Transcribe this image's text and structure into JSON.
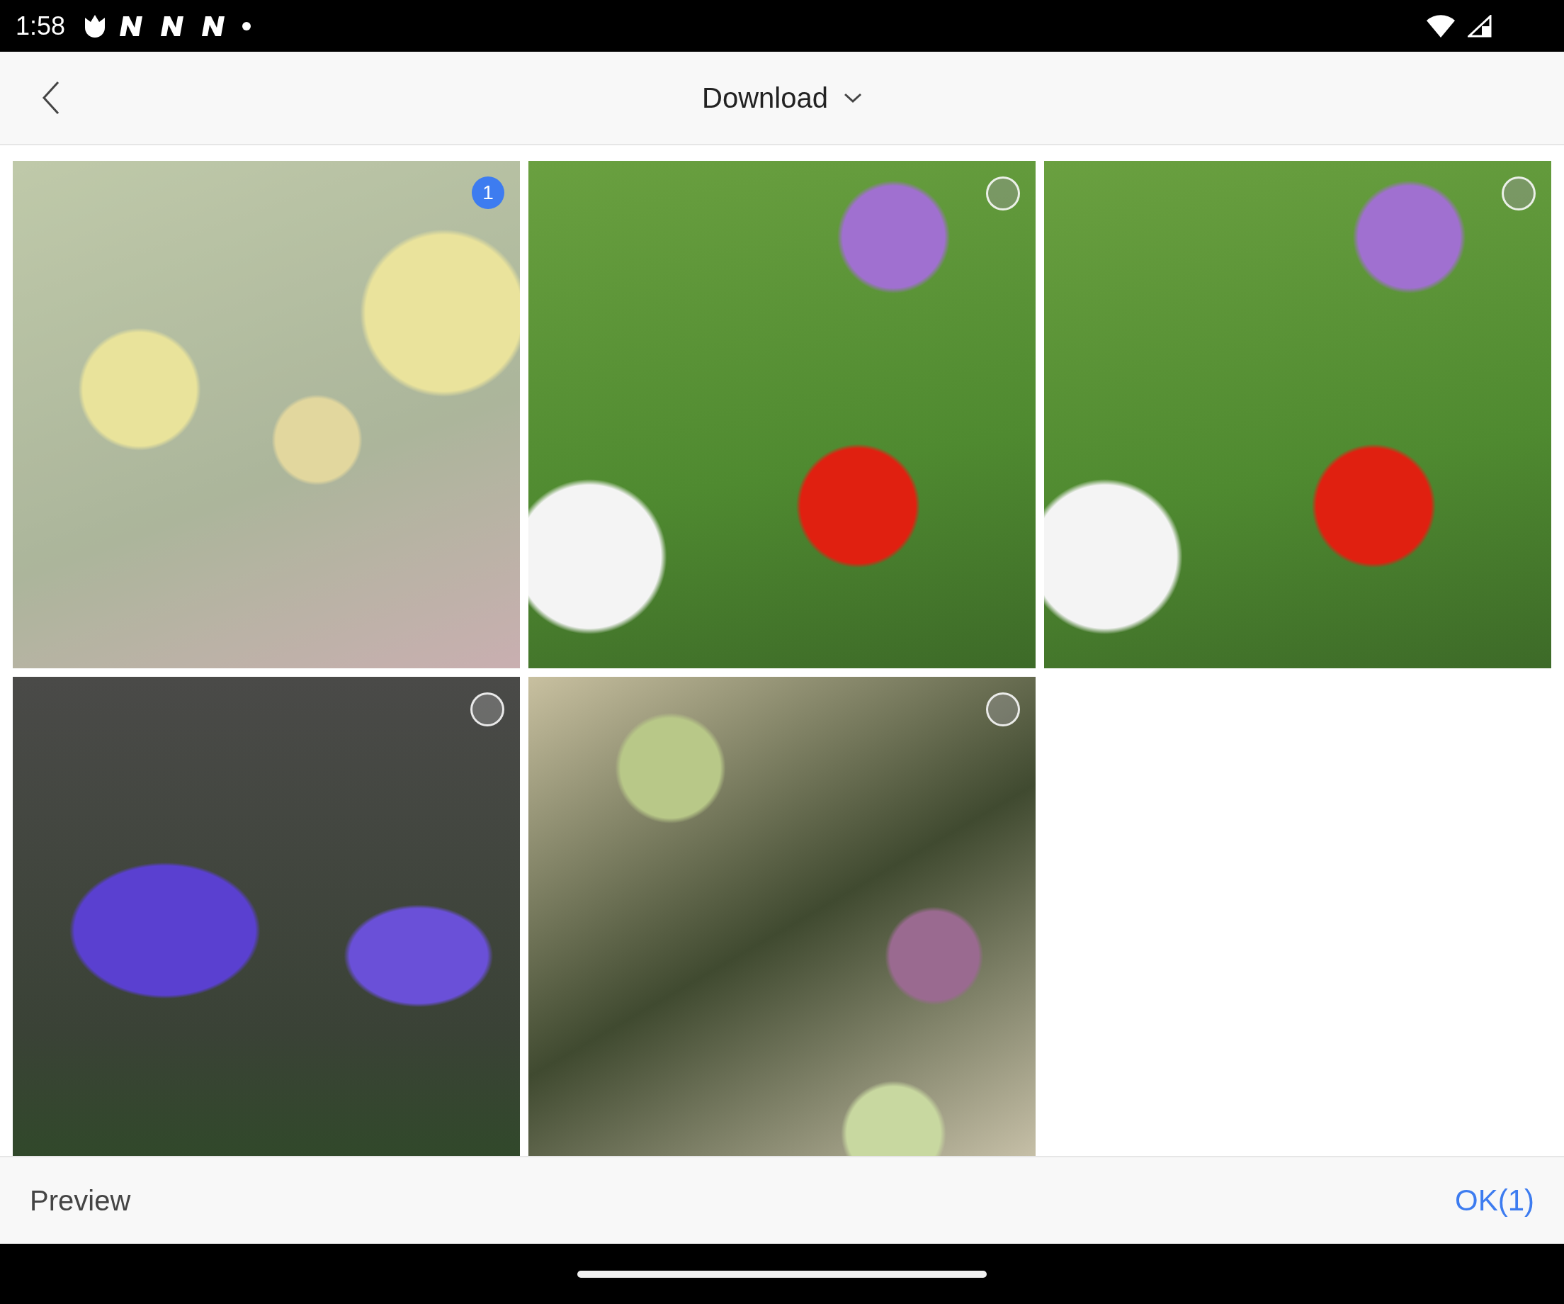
{
  "status_bar": {
    "time": "1:58"
  },
  "header": {
    "title": "Download"
  },
  "photos": [
    {
      "selected": true,
      "order": "1"
    },
    {
      "selected": false
    },
    {
      "selected": false
    },
    {
      "selected": false
    },
    {
      "selected": false
    }
  ],
  "bottom_bar": {
    "preview": "Preview",
    "ok": "OK(1)"
  }
}
